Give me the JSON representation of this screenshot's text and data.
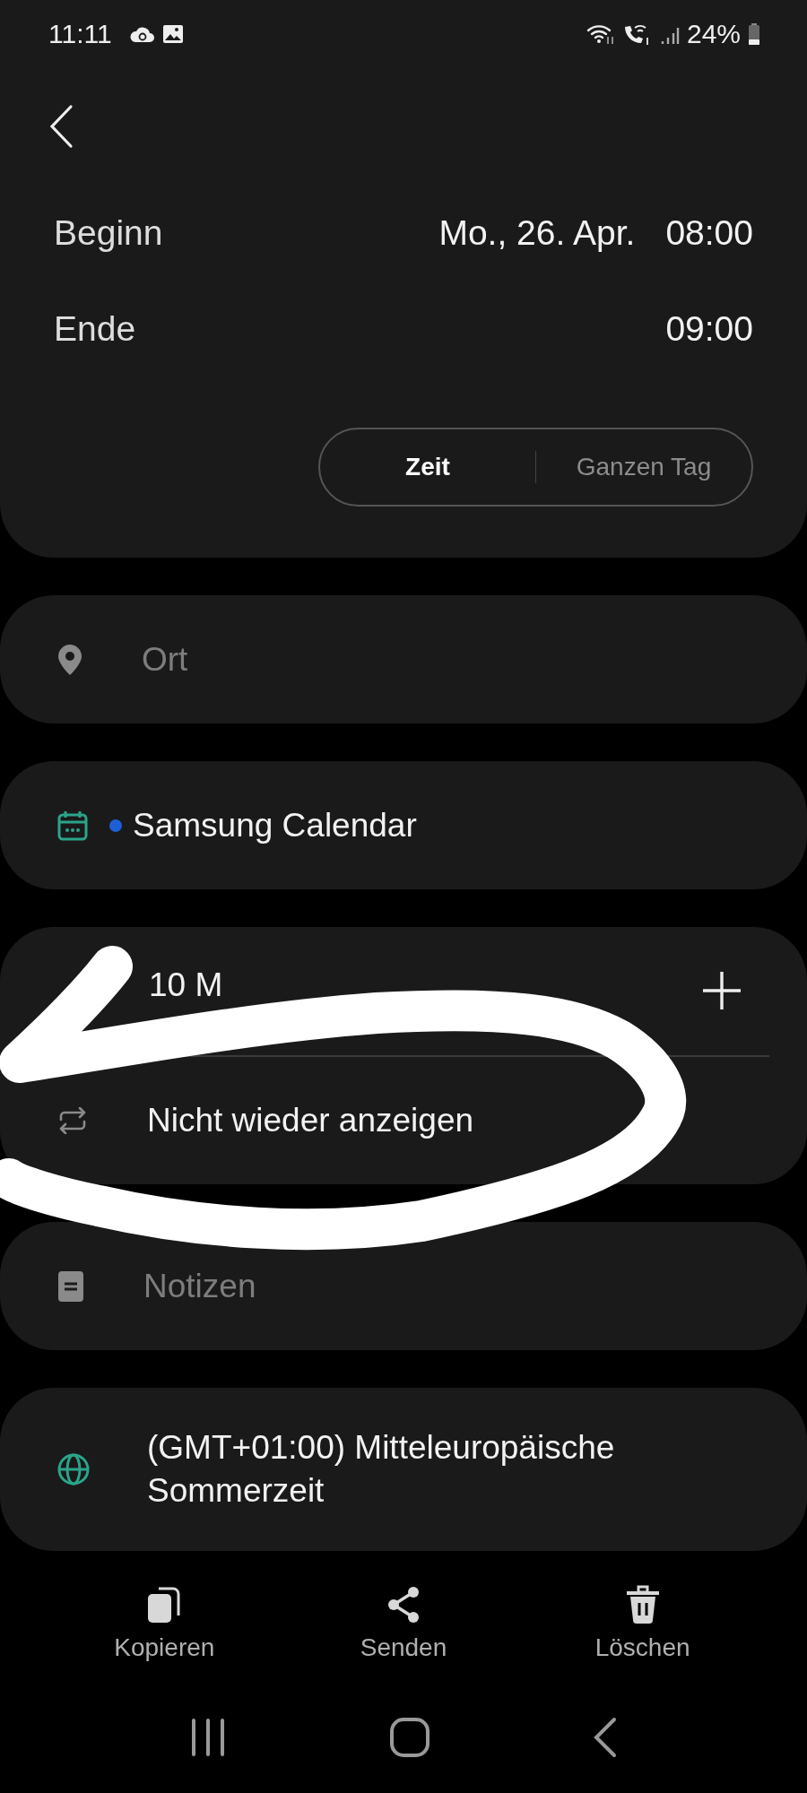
{
  "status_bar": {
    "time": "11:11",
    "battery": "24%"
  },
  "schedule": {
    "rows": [
      {
        "label": "Beginn",
        "date": "Mo., 26. Apr.",
        "time": "08:00"
      },
      {
        "label": "Ende",
        "time": "09:00"
      }
    ],
    "toggle": [
      {
        "label": "Zeit",
        "selected": true
      },
      {
        "label": "Ganzen Tag",
        "selected": false
      }
    ]
  },
  "fields": [
    {
      "kind": "location",
      "placeholder": "Ort"
    },
    {
      "kind": "calendar",
      "value": "Samsung Calendar",
      "color": "#1f5fd6"
    },
    {
      "kind": "reminder",
      "reminder": "10 M",
      "repeat": "Nicht wieder anzeigen"
    },
    {
      "kind": "notes",
      "placeholder": "Notizen"
    },
    {
      "kind": "timezone",
      "value": "(GMT+01:00) Mitteleuropäische Sommerzeit"
    }
  ],
  "actions": [
    {
      "kind": "copy",
      "label": "Kopieren"
    },
    {
      "kind": "share",
      "label": "Senden"
    },
    {
      "kind": "delete",
      "label": "Löschen"
    }
  ]
}
